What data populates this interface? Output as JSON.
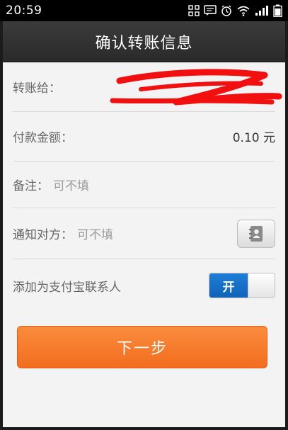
{
  "status_bar": {
    "time": "20:59"
  },
  "header": {
    "title": "确认转账信息"
  },
  "form": {
    "recipient_label": "转账给：",
    "amount_label": "付款金额：",
    "amount_value": "0.10 元",
    "remark_label": "备注：",
    "remark_placeholder": "可不填",
    "notify_label": "通知对方：",
    "notify_placeholder": "可不填",
    "contact_label": "添加为支付宝联系人",
    "contact_toggle": "开"
  },
  "actions": {
    "next_label": "下一步"
  },
  "colors": {
    "accent": "#f2742a",
    "toggle_on": "#1a74cf"
  },
  "icons": [
    "grid-icon",
    "message-icon",
    "alarm-icon",
    "wifi-icon",
    "signal-icon",
    "battery-icon",
    "address-book-icon"
  ]
}
